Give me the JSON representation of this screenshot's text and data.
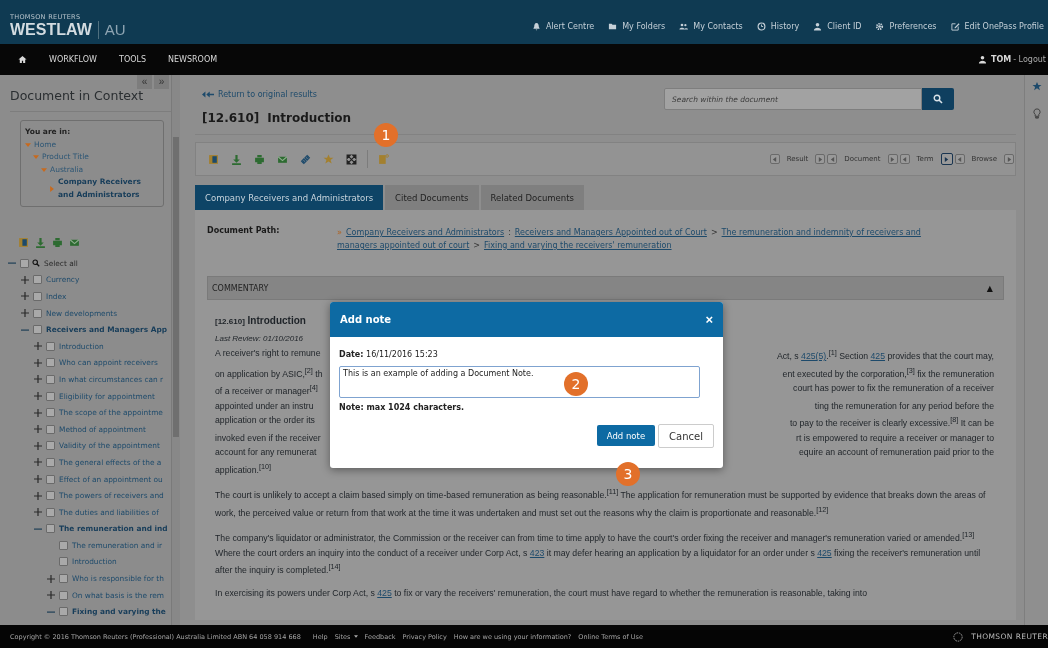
{
  "header": {
    "brand_small": "THOMSON REUTERS",
    "brand": "WESTLAW",
    "region": "AU",
    "links": [
      {
        "kind": "bell",
        "label": "Alert Centre"
      },
      {
        "kind": "folder",
        "label": "My Folders"
      },
      {
        "kind": "people",
        "label": "My Contacts"
      },
      {
        "kind": "clock",
        "label": "History"
      },
      {
        "kind": "person",
        "label": "Client ID"
      },
      {
        "kind": "gear",
        "label": "Preferences"
      },
      {
        "kind": "edit",
        "label": "Edit OnePass Profile"
      }
    ]
  },
  "nav": {
    "items": [
      "WORKFLOW",
      "TOOLS",
      "NEWSROOM"
    ],
    "user": "TOM",
    "logout": "- Logout"
  },
  "sidebar": {
    "collapse": "«",
    "expand": "»",
    "title": "Document in Context",
    "breadcrumb": {
      "heading": "You are in:",
      "items": [
        {
          "label": "Home",
          "selected": false,
          "children": [
            {
              "label": "Product Title",
              "selected": false,
              "children": [
                {
                  "label": "Australia",
                  "selected": false,
                  "children": [
                    {
                      "label": "Company Receivers and Administrators",
                      "selected": true
                    }
                  ]
                }
              ]
            }
          ]
        }
      ]
    },
    "tree": [
      {
        "label": "Select all",
        "expanded": true,
        "checked": false,
        "bold": false,
        "children": [
          {
            "label": "Currency",
            "expanded": false,
            "checked": false,
            "bold": false
          },
          {
            "label": "Index",
            "expanded": false,
            "checked": false,
            "bold": false
          },
          {
            "label": "New developments",
            "expanded": false,
            "checked": false,
            "bold": false
          },
          {
            "label": "Receivers and Managers App",
            "expanded": true,
            "checked": false,
            "bold": true,
            "children": [
              {
                "label": "Introduction",
                "expanded": false,
                "checked": false,
                "bold": false
              },
              {
                "label": "Who can appoint receivers",
                "expanded": false,
                "checked": false,
                "bold": false
              },
              {
                "label": "In what circumstances can r",
                "expanded": false,
                "checked": false,
                "bold": false
              },
              {
                "label": "Eligibility for appointment",
                "expanded": false,
                "checked": false,
                "bold": false
              },
              {
                "label": "The scope of the appointme",
                "expanded": false,
                "checked": false,
                "bold": false
              },
              {
                "label": "Method of appointment",
                "expanded": false,
                "checked": false,
                "bold": false
              },
              {
                "label": "Validity of the appointment",
                "expanded": false,
                "checked": false,
                "bold": false
              },
              {
                "label": "The general effects of the a",
                "expanded": false,
                "checked": false,
                "bold": false
              },
              {
                "label": "Effect of an appointment ou",
                "expanded": false,
                "checked": false,
                "bold": false
              },
              {
                "label": "The powers of receivers and",
                "expanded": false,
                "checked": false,
                "bold": false
              },
              {
                "label": "The duties and liabilities of",
                "expanded": false,
                "checked": false,
                "bold": false
              },
              {
                "label": "The remuneration and ind",
                "expanded": true,
                "checked": false,
                "bold": true,
                "children": [
                  {
                    "label": "The remuneration and ir",
                    "checked": false,
                    "bold": false
                  },
                  {
                    "label": "Introduction",
                    "checked": false,
                    "bold": false
                  },
                  {
                    "label": "Who is responsible for th",
                    "expanded": false,
                    "checked": false,
                    "bold": false
                  },
                  {
                    "label": "On what basis is the rem",
                    "expanded": false,
                    "checked": false,
                    "bold": false
                  },
                  {
                    "label": "Fixing and varying the",
                    "expanded": true,
                    "checked": false,
                    "bold": true
                  }
                ]
              }
            ]
          }
        ]
      }
    ]
  },
  "document": {
    "return_link": "Return to original results",
    "search": {
      "placeholder": "Search within the document"
    },
    "number": "[12.610]",
    "title": "Introduction",
    "result_nav": [
      {
        "label": "Result",
        "next_highlighted": false
      },
      {
        "label": "Document",
        "next_highlighted": false
      },
      {
        "label": "Term",
        "next_highlighted": true
      },
      {
        "label": "Browse",
        "next_highlighted": false
      }
    ],
    "tabs": [
      {
        "label": "Company Receivers and Administrators",
        "selected": true
      },
      {
        "label": "Cited Documents",
        "selected": false
      },
      {
        "label": "Related Documents",
        "selected": false
      }
    ],
    "path_label": "Document Path:",
    "path": [
      {
        "separator": "»",
        "label": "Company Receivers and Administrators"
      },
      {
        "separator": ":",
        "label": "Receivers and Managers Appointed out of Court"
      },
      {
        "separator": ">",
        "label": "The remuneration and indemnity of receivers and managers appointed out of court"
      },
      {
        "separator": ">",
        "label": "Fixing and varying the receivers' remuneration"
      }
    ],
    "section": {
      "label": "COMMENTARY",
      "toggle": "▲",
      "expanded": true
    },
    "heading_number": "[12.610]",
    "heading": "Introduction",
    "last_review": "Last Review: 01/10/2016",
    "first_paragraph_lines": [
      {
        "left": [
          {
            "text": "A receiver's right to remune",
            "link": false
          }
        ],
        "right": [
          {
            "text": "Act, s ",
            "link": false
          },
          {
            "text": "425(5)",
            "link": true
          },
          {
            "text": ".$^{[1]}$ Section ",
            "link": false
          },
          {
            "text": "425",
            "link": true
          },
          {
            "text": " provides that the court may,",
            "link": false
          }
        ]
      },
      {
        "left": [
          {
            "text": "on application by ASIC,$^{[2]}$ th",
            "link": false
          }
        ],
        "right": [
          {
            "text": "ent executed by the corporation,$^{[3]}$ fix the remuneration",
            "link": false
          }
        ]
      },
      {
        "left": [
          {
            "text": "of a receiver or manager$^{[4]}$",
            "link": false
          }
        ],
        "right": [
          {
            "text": "court has power to fix the remuneration of a receiver",
            "link": false
          }
        ]
      },
      {
        "left": [
          {
            "text": "appointed under an instru",
            "link": false
          }
        ],
        "right": [
          {
            "text": "ting the remuneration for any period before the",
            "link": false
          }
        ]
      },
      {
        "left": [
          {
            "text": "application or the order its",
            "link": false
          }
        ],
        "right": [
          {
            "text": "to pay to the receiver is clearly excessive.$^{[8]}$ It can be",
            "link": false
          }
        ]
      },
      {
        "left": [
          {
            "text": "invoked even if the receiver",
            "link": false
          }
        ],
        "right": [
          {
            "text": "rt is empowered to require a receiver or manager to",
            "link": false
          }
        ]
      },
      {
        "left": [
          {
            "text": "account for any remunerat",
            "link": false
          }
        ],
        "right": [
          {
            "text": "equire an account of remuneration paid prior to the",
            "link": false
          }
        ]
      },
      {
        "left": [
          {
            "text": "application.$^{[10]}$",
            "link": false
          }
        ]
      }
    ],
    "paragraphs": [
      [
        {
          "text": "The court is unlikely to accept a claim based simply on time-based remuneration as being reasonable.$^{[11]}$ The application for remuneration must be supported by evidence that breaks down the areas of work, the perceived value or return from that work at the time it was undertaken and must set out the reasons why the claim is proportionate and reasonable.$^{[12]}$",
          "link": false
        }
      ],
      [
        {
          "text": "The company's liquidator or administrator, the Commission or the receiver can from time to time apply to have the court's order fixing the receiver and manager's remuneration varied or amended.$^{[13]}$ Where the court orders an inquiry into the conduct of a receiver under Corp Act, s ",
          "link": false
        },
        {
          "text": "423",
          "link": true
        },
        {
          "text": " it may defer hearing an application by a liquidator for an order under s ",
          "link": false
        },
        {
          "text": "425",
          "link": true
        },
        {
          "text": " fixing the receiver's remuneration until after the inquiry is completed.$^{[14]}$",
          "link": false
        }
      ],
      [
        {
          "text": "In exercising its powers under Corp Act, s ",
          "link": false
        },
        {
          "text": "425",
          "link": true
        },
        {
          "text": " to fix or vary the receivers' remuneration, the court must have regard to whether the remuneration is reasonable, taking into",
          "link": false
        }
      ]
    ]
  },
  "modal": {
    "title": "Add note",
    "close": "×",
    "date_label": "Date:",
    "date": "16/11/2016 15:23",
    "note": "This is an example of adding a Document Note.",
    "hint": "Note: max 1024 characters.",
    "buttons": [
      {
        "label": "Add note",
        "kind": "primary"
      },
      {
        "label": "Cancel",
        "kind": "secondary"
      }
    ]
  },
  "callouts": [
    "1",
    "2",
    "3"
  ],
  "footer": {
    "copyright": "Copyright © 2016 Thomson Reuters (Professional) Australia Limited ABN 64 058 914 668",
    "links": [
      "Help",
      "Sites",
      "Feedback",
      "Privacy Policy",
      "How are we using your information?",
      "Online Terms of Use"
    ],
    "logo": "THOMSON REUTER"
  }
}
